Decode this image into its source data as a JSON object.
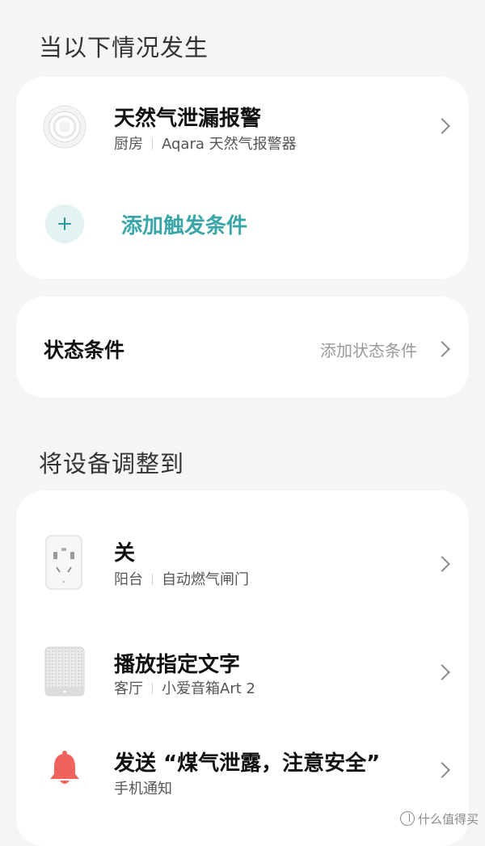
{
  "trigger_section": {
    "title": "当以下情况发生",
    "trigger": {
      "title": "天然气泄漏报警",
      "room": "厨房",
      "device": "Aqara 天然气报警器",
      "icon": "gas-detector-icon"
    },
    "add_trigger_label": "添加触发条件"
  },
  "status_section": {
    "label": "状态条件",
    "link": "添加状态条件"
  },
  "action_section": {
    "title": "将设备调整到",
    "actions": [
      {
        "title": "关",
        "room": "阳台",
        "device": "自动燃气闸门",
        "icon": "smart-plug-icon"
      },
      {
        "title": "播放指定文字",
        "room": "客厅",
        "device": "小爱音箱Art 2",
        "icon": "speaker-icon"
      },
      {
        "title": "发送 “煤气泄露，注意安全”",
        "subtitle": "手机通知",
        "icon": "bell-icon"
      }
    ]
  },
  "watermark": "什么值得买",
  "colors": {
    "accent": "#3aa6a8",
    "background": "#f5f5f5",
    "bell": "#f0625c"
  }
}
